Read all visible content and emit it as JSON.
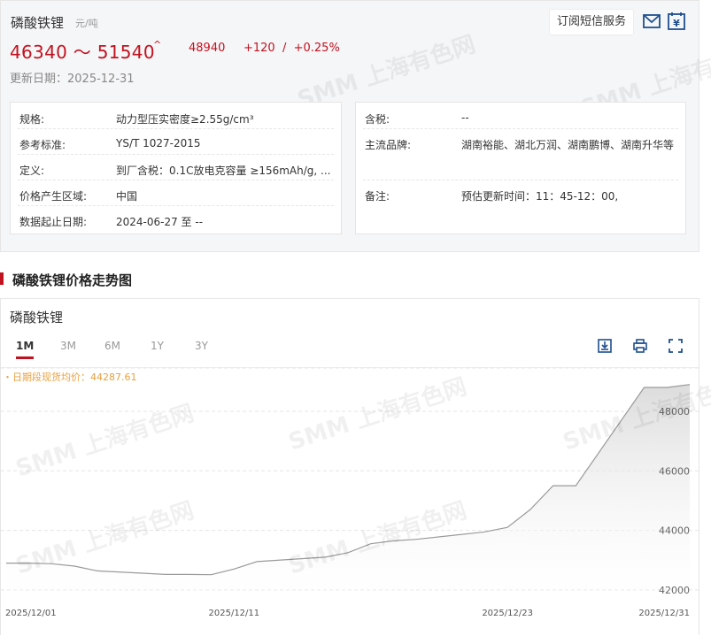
{
  "header": {
    "title": "磷酸铁锂",
    "unit": "元/吨",
    "price_range": "46340 ～ 51540",
    "up_arrow": "^",
    "avg_price": "48940",
    "change": "+120  /  +0.25%",
    "update_date": "更新日期：2025-12-31",
    "subscribe_label": "订阅短信服务"
  },
  "specs_left": [
    {
      "label": "规格:",
      "value": "动力型压实密度≥2.55g/cm³"
    },
    {
      "label": "参考标准:",
      "value": "YS/T 1027-2015"
    },
    {
      "label": "定义:",
      "value": "到厂含税：0.1C放电克容量 ≥156mAh/g, ..."
    },
    {
      "label": "价格产生区域:",
      "value": "中国"
    },
    {
      "label": "数据起止日期:",
      "value": "2024-06-27 至 --"
    }
  ],
  "specs_right": [
    {
      "label": "含税:",
      "value": "--"
    },
    {
      "label": "主流品牌:",
      "value": "湖南裕能、湖北万润、湖南鹏博、湖南升华等"
    },
    {
      "label": "备注:",
      "value": "预估更新时间：11：45-12：00,"
    }
  ],
  "section": {
    "title": "磷酸铁锂价格走势图"
  },
  "chart_panel": {
    "name": "磷酸铁锂",
    "tabs": [
      "1M",
      "3M",
      "6M",
      "1Y",
      "3Y"
    ],
    "active_tab": "1M",
    "avg_text": "・日期段现货均价：44287.61",
    "watermark": "SMM 上海有色网"
  },
  "colors": {
    "accent": "#c1121f",
    "avg_text": "#e8a040",
    "line": "#9a9a9a"
  },
  "icons": [
    "mail-icon",
    "calendar-yuan-icon",
    "download-icon",
    "print-icon",
    "fullscreen-icon"
  ],
  "chart_data": {
    "type": "area",
    "x_tick_labels": [
      "2025/12/01",
      "2025/12/11",
      "2025/12/23",
      "2025/12/31"
    ],
    "x_tick_dates": [
      "2025-12-01",
      "2025-12-11",
      "2025-12-23",
      "2025-12-31"
    ],
    "y_tick_labels": [
      "42000",
      "44000",
      "46000",
      "48000"
    ],
    "ylim": [
      41700,
      48950
    ],
    "grid": true,
    "legend": "none",
    "x": [
      "2025-12-01",
      "2025-12-02",
      "2025-12-03",
      "2025-12-04",
      "2025-12-05",
      "2025-12-08",
      "2025-12-09",
      "2025-12-10",
      "2025-12-11",
      "2025-12-12",
      "2025-12-15",
      "2025-12-16",
      "2025-12-17",
      "2025-12-18",
      "2025-12-19",
      "2025-12-22",
      "2025-12-23",
      "2025-12-24",
      "2025-12-25",
      "2025-12-26",
      "2025-12-29",
      "2025-12-30",
      "2025-12-31"
    ],
    "y": [
      42900,
      42900,
      42880,
      42800,
      42640,
      42520,
      42520,
      42510,
      42700,
      42950,
      43100,
      43250,
      43550,
      43650,
      43700,
      43950,
      44100,
      44700,
      45500,
      45500,
      48800,
      48800,
      48900
    ]
  }
}
